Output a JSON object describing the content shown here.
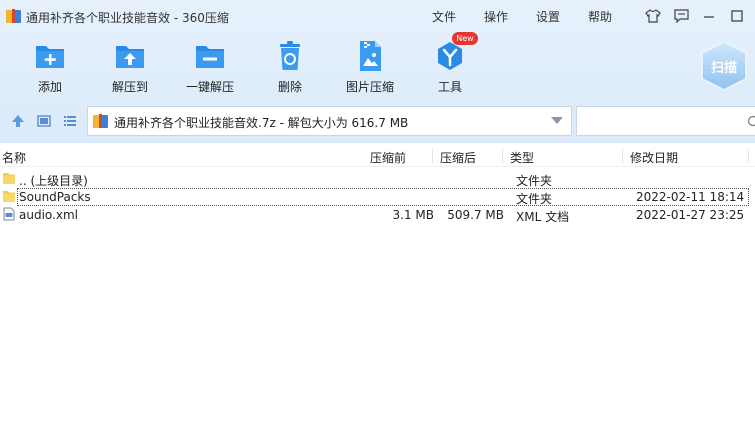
{
  "window": {
    "title": "通用补齐各个职业技能音效 - 360压缩",
    "menu": [
      {
        "label": "文件"
      },
      {
        "label": "操作"
      },
      {
        "label": "设置"
      },
      {
        "label": "帮助"
      }
    ]
  },
  "toolbar": {
    "items": [
      {
        "label": "添加",
        "icon": "add-icon"
      },
      {
        "label": "解压到",
        "icon": "extract-to-icon"
      },
      {
        "label": "一键解压",
        "icon": "one-click-extract-icon"
      },
      {
        "label": "删除",
        "icon": "delete-icon"
      },
      {
        "label": "图片压缩",
        "icon": "image-compress-icon"
      },
      {
        "label": "工具",
        "icon": "tools-icon"
      }
    ],
    "new_badge": "New",
    "scan_label": "扫描"
  },
  "address": {
    "path": "通用补齐各个职业技能音效.7z - 解包大小为 616.7 MB",
    "search_placeholder": ""
  },
  "columns": {
    "name": "名称",
    "compressed_before": "压缩前",
    "compressed_after": "压缩后",
    "type": "类型",
    "modified": "修改日期"
  },
  "files": [
    {
      "name": ".. (上级目录)",
      "before": "",
      "after": "",
      "type": "文件夹",
      "modified": "",
      "icon": "folder-icon"
    },
    {
      "name": "SoundPacks",
      "before": "",
      "after": "",
      "type": "文件夹",
      "modified": "2022-02-11 18:14",
      "icon": "folder-icon"
    },
    {
      "name": "audio.xml",
      "before": "3.1 MB",
      "after": "509.7 MB",
      "type": "XML 文档",
      "modified": "2022-01-27 23:25",
      "icon": "xml-file-icon"
    }
  ],
  "colors": {
    "accent": "#2a8be6",
    "toolbar_bg": "#e3eefb",
    "badge": "#e8352f",
    "folder": "#f6c94f"
  }
}
